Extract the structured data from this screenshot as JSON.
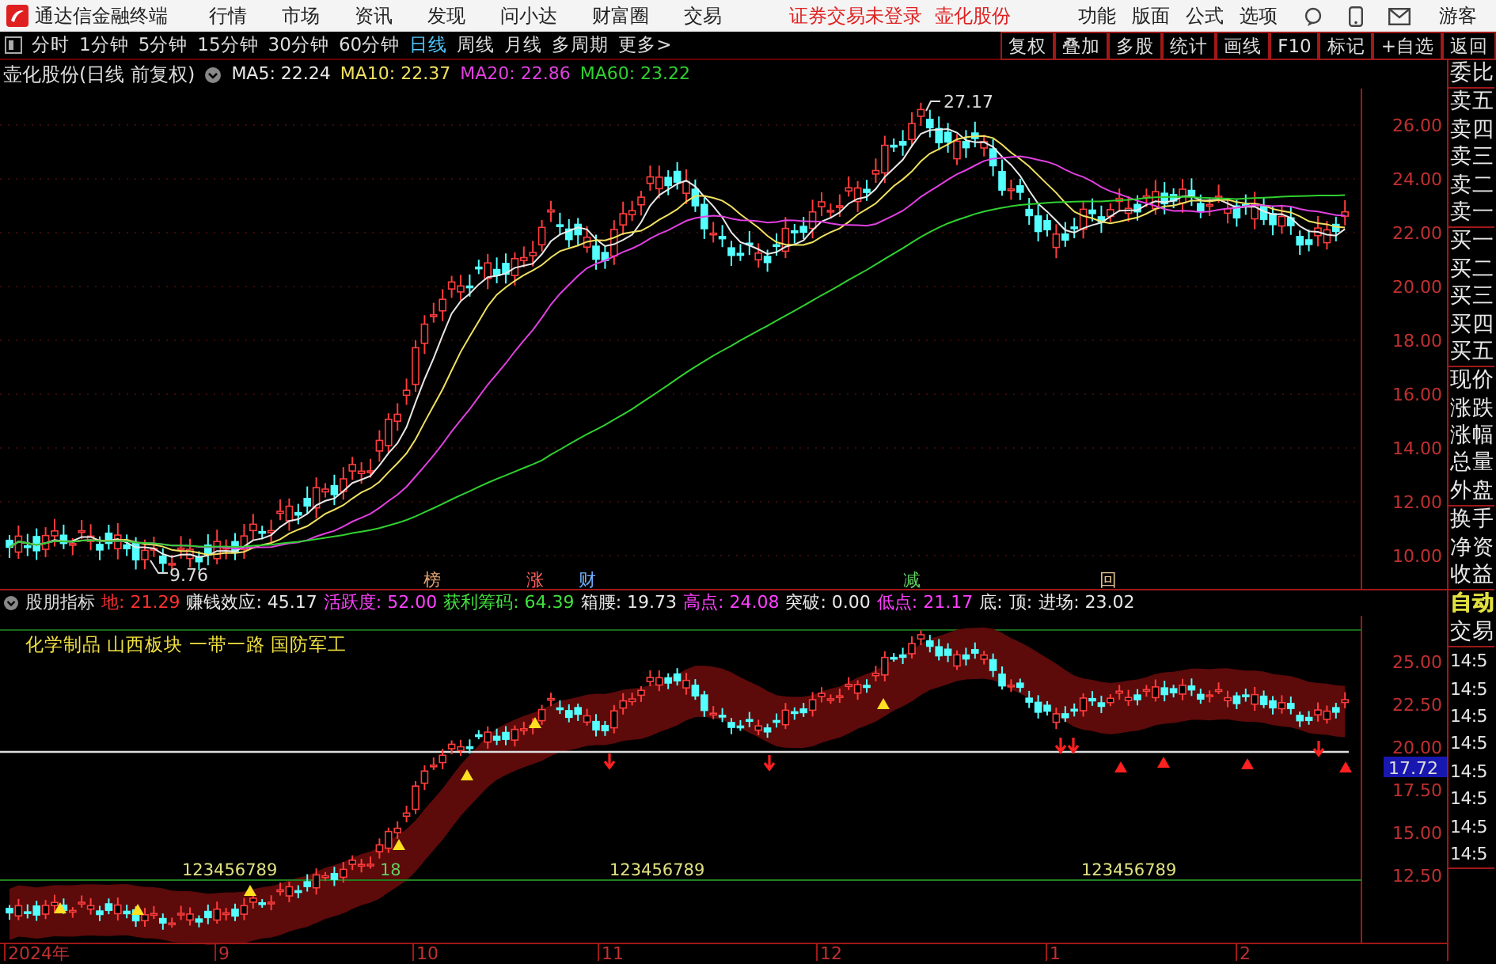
{
  "app": {
    "title": "通达信金融终端"
  },
  "menu": [
    "行情",
    "市场",
    "资讯",
    "发现",
    "问小达",
    "财富圈",
    "交易"
  ],
  "notices": [
    "证券交易未登录",
    "壶化股份"
  ],
  "tools_menu": [
    "功能",
    "版面",
    "公式",
    "选项"
  ],
  "user": "游客",
  "periods": [
    {
      "label": "分时",
      "selected": false
    },
    {
      "label": "1分钟",
      "selected": false
    },
    {
      "label": "5分钟",
      "selected": false
    },
    {
      "label": "15分钟",
      "selected": false
    },
    {
      "label": "30分钟",
      "selected": false
    },
    {
      "label": "60分钟",
      "selected": false
    },
    {
      "label": "日线",
      "selected": true
    },
    {
      "label": "周线",
      "selected": false
    },
    {
      "label": "月线",
      "selected": false
    },
    {
      "label": "多周期",
      "selected": false
    },
    {
      "label": "更多>",
      "selected": false
    }
  ],
  "toolbar_buttons": [
    "复权",
    "叠加",
    "多股",
    "统计",
    "画线",
    "F10",
    "标记",
    "+自选",
    "返回"
  ],
  "main_chart": {
    "title": "壶化股份(日线 前复权)",
    "indicators": [
      {
        "text": "MA5: 22.24",
        "color": "#e8e8e8"
      },
      {
        "text": "MA10: 22.37",
        "color": "#f0e060"
      },
      {
        "text": "MA20: 22.86",
        "color": "#e040e0"
      },
      {
        "text": "MA60: 23.22",
        "color": "#30d030"
      }
    ],
    "y_ticks": [
      "26.00",
      "24.00",
      "22.00",
      "20.00",
      "18.00",
      "16.00",
      "14.00",
      "12.00",
      "10.00"
    ],
    "high_label": "27.17",
    "low_label": "9.76",
    "signals": [
      {
        "text": "榜",
        "color": "#e0a070"
      },
      {
        "text": "涨",
        "color": "#ff6060"
      },
      {
        "text": "财",
        "color": "#70b0ff"
      },
      {
        "text": "减",
        "color": "#60d060"
      },
      {
        "text": "回",
        "color": "#e0c090"
      }
    ]
  },
  "indicator_panel": {
    "name": "股朋指标",
    "values": [
      {
        "text": "地: 21.29",
        "color": "#ff3030"
      },
      {
        "text": "赚钱效应: 45.17",
        "color": "#e8e8e8"
      },
      {
        "text": "活跃度: 52.00",
        "color": "#ff40ff"
      },
      {
        "text": "获利筹码: 64.39",
        "color": "#40e040"
      },
      {
        "text": "箱腰: 19.73",
        "color": "#e8e8e8"
      },
      {
        "text": "高点: 24.08",
        "color": "#ff40ff"
      },
      {
        "text": "突破: 0.00",
        "color": "#e8e8e8"
      },
      {
        "text": "低点: 21.17",
        "color": "#ff40ff"
      },
      {
        "text": "底:",
        "color": "#e8e8e8"
      },
      {
        "text": "顶:",
        "color": "#e8e8e8"
      },
      {
        "text": "进场: 23.02",
        "color": "#e8e8e8"
      }
    ],
    "sectors": "化学制品 山西板块 一带一路 国防军工",
    "y_ticks": [
      "25.00",
      "22.50",
      "20.00",
      "17.50",
      "15.00",
      "12.50"
    ],
    "cursor_value": "17.72",
    "counts": [
      "123456789",
      "18",
      "123456789",
      "123456789"
    ]
  },
  "x_axis": [
    "2024年",
    "9",
    "10",
    "11",
    "12",
    "1",
    "2"
  ],
  "side_panel": [
    [
      {
        "label": "委比"
      }
    ],
    [
      {
        "label": "卖五"
      },
      {
        "label": "卖四"
      },
      {
        "label": "卖三"
      },
      {
        "label": "卖二"
      },
      {
        "label": "卖一"
      }
    ],
    [
      {
        "label": "买一"
      },
      {
        "label": "买二"
      },
      {
        "label": "买三"
      },
      {
        "label": "买四"
      },
      {
        "label": "买五"
      }
    ],
    [
      {
        "label": "现价"
      },
      {
        "label": "涨跌"
      },
      {
        "label": "涨幅"
      },
      {
        "label": "总量"
      },
      {
        "label": "外盘"
      }
    ],
    [
      {
        "label": "换手"
      },
      {
        "label": "净资"
      },
      {
        "label": "收益"
      }
    ],
    [
      {
        "label": "自动",
        "color": "#e0e040"
      },
      {
        "label": "交易"
      }
    ],
    [
      {
        "label": "14:5"
      },
      {
        "label": "14:5"
      },
      {
        "label": "14:5"
      },
      {
        "label": "14:5"
      },
      {
        "label": "14:5"
      },
      {
        "label": "14:5"
      },
      {
        "label": "14:5"
      },
      {
        "label": "14:5"
      }
    ]
  ]
}
